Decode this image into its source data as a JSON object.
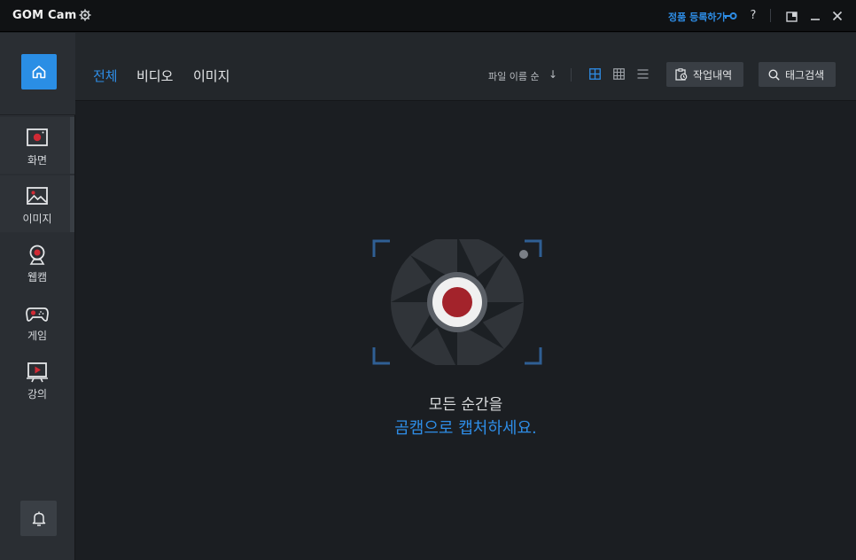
{
  "app": {
    "logo_text": "GOM Cam",
    "register_label": "정품 등록하기",
    "help_label": "?"
  },
  "sidebar": {
    "items": [
      {
        "label": "화면",
        "icon": "screen-record-icon"
      },
      {
        "label": "이미지",
        "icon": "image-capture-icon"
      },
      {
        "label": "웹캠",
        "icon": "webcam-icon"
      },
      {
        "label": "게임",
        "icon": "gamepad-icon"
      },
      {
        "label": "강의",
        "icon": "lecture-icon"
      }
    ]
  },
  "tabs": [
    {
      "label": "전체",
      "active": true
    },
    {
      "label": "비디오",
      "active": false
    },
    {
      "label": "이미지",
      "active": false
    }
  ],
  "toolbar": {
    "sort_label": "파일 이름 순",
    "sort_arrow": "↓",
    "history_label": "작업내역",
    "tag_search_label": "태그검색"
  },
  "empty_state": {
    "line1": "모든 순간을",
    "line2": "곰캠으로 캡처하세요."
  },
  "colors": {
    "accent": "#2e8de6",
    "record_red": "#a3232b",
    "background": "#1b1e22"
  }
}
